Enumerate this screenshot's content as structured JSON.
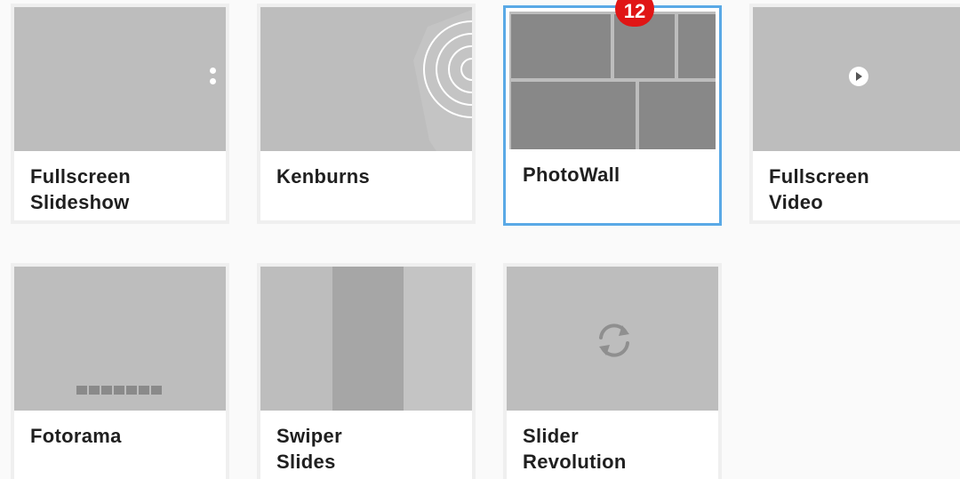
{
  "badge": {
    "value": "12"
  },
  "cards": [
    {
      "label_line1": "Fullscreen",
      "label_line2": "Slideshow",
      "icon": "dots-icon"
    },
    {
      "label_line1": "Kenburns",
      "label_line2": "",
      "icon": "concentric-circles-icon"
    },
    {
      "label_line1": "PhotoWall",
      "label_line2": "",
      "icon": "photo-grid",
      "selected": true
    },
    {
      "label_line1": "Fullscreen",
      "label_line2": "Video",
      "icon": "play-icon"
    },
    {
      "label_line1": "Fotorama",
      "label_line2": "",
      "icon": "thumbnail-strip-icon"
    },
    {
      "label_line1": "Swiper",
      "label_line2": "Slides",
      "icon": "swipe-panels"
    },
    {
      "label_line1": "Slider",
      "label_line2": "Revolution",
      "icon": "refresh-icon"
    }
  ],
  "colors": {
    "selected_border": "#5aa9e6",
    "badge_bg": "#e01515",
    "thumb_bg": "#bdbdbd"
  }
}
